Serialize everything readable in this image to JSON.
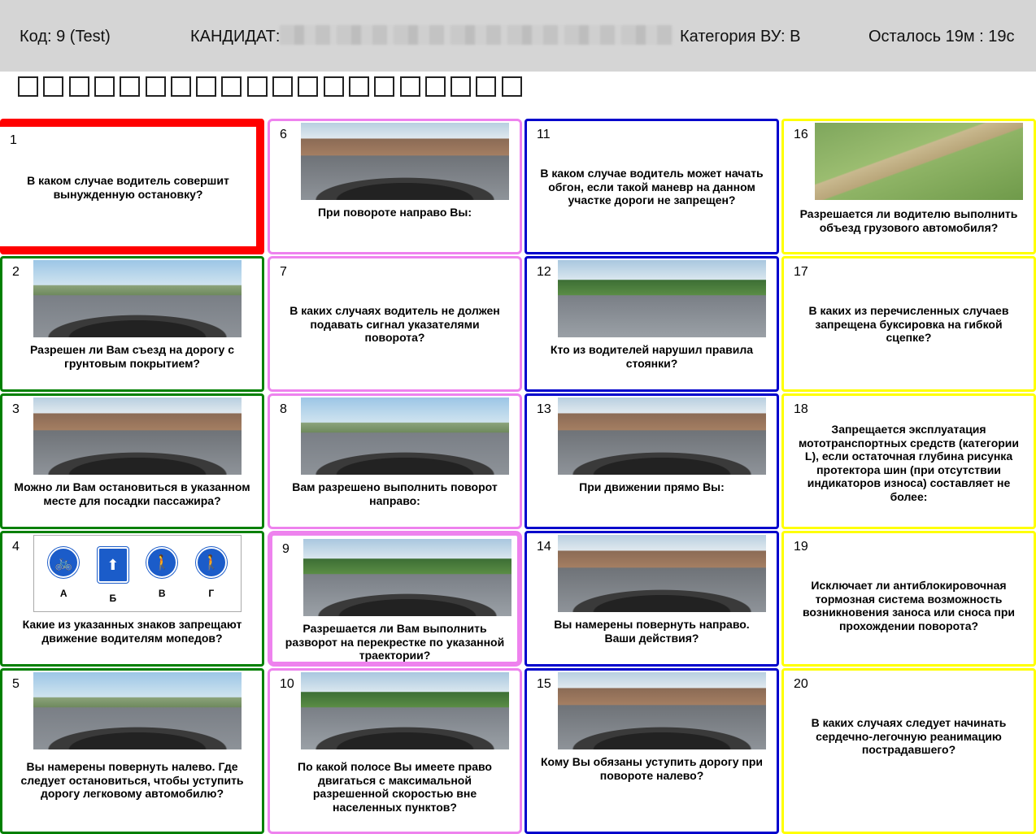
{
  "header": {
    "code": "Код: 9 (Test)",
    "candidate_label": "КАНДИДАТ:",
    "category": "Категория ВУ: B",
    "timer": "Осталось 19м : 19с"
  },
  "progress": {
    "total": 20,
    "answered": 0
  },
  "colors": {
    "red": "#ff0000",
    "green": "#008000",
    "pink": "#ee82ee",
    "blue": "#0000cc",
    "yellow": "#ffff00",
    "header_bg": "#d5d5d5"
  },
  "cards": [
    {
      "num": "1",
      "text": "В каком случае водитель совершит вынужденную остановку?",
      "border": "red",
      "image": "none"
    },
    {
      "num": "2",
      "text": "Разрешен ли Вам съезд на дорогу с грунтовым покрытием?",
      "border": "green",
      "image": "road-warning-sign"
    },
    {
      "num": "3",
      "text": "Можно ли Вам остановиться в указанном месте для посадки пассажира?",
      "border": "green",
      "image": "city-street-no-parking-sign"
    },
    {
      "num": "4",
      "text": "Какие из указанных знаков запрещают движение водителям мопедов?",
      "border": "green",
      "image": "four-signs",
      "signs": [
        {
          "label": "А",
          "icon": "bicycle-icon"
        },
        {
          "label": "Б",
          "icon": "bus-lane-icon"
        },
        {
          "label": "В",
          "icon": "pedestrian-bicycle-icon"
        },
        {
          "label": "Г",
          "icon": "pedestrian-bicycle-split-icon"
        }
      ]
    },
    {
      "num": "5",
      "text": "Вы намерены повернуть налево. Где следует остановиться, чтобы уступить дорогу легковому автомобилю?",
      "border": "green",
      "image": "intersection-yield-sign"
    },
    {
      "num": "6",
      "text": "При повороте направо Вы:",
      "border": "pink",
      "image": "intersection-police-car"
    },
    {
      "num": "7",
      "text": "В каких случаях водитель не должен подавать сигнал указателями поворота?",
      "border": "pink",
      "image": "none"
    },
    {
      "num": "8",
      "text": "Вам разрешено выполнить поворот направо:",
      "border": "pink",
      "image": "road-right-turn-sign"
    },
    {
      "num": "9",
      "text": "Разрешается ли Вам выполнить разворот на перекрестке по указанной траектории?",
      "border": "pink-thick",
      "image": "road-u-turn"
    },
    {
      "num": "10",
      "text": "По какой полосе Вы имеете право двигаться с максимальной разрешенной скоростью вне населенных пунктов?",
      "border": "pink",
      "image": "highway"
    },
    {
      "num": "11",
      "text": "В каком случае водитель может начать обгон, если такой маневр на данном участке дороги не запрещен?",
      "border": "blue",
      "image": "none"
    },
    {
      "num": "12",
      "text": "Кто из водителей нарушил правила стоянки?",
      "border": "blue",
      "image": "street-parking-3m"
    },
    {
      "num": "13",
      "text": "При движении прямо Вы:",
      "border": "blue",
      "image": "city-intersection-stop"
    },
    {
      "num": "14",
      "text": "Вы намерены повернуть направо. Ваши действия?",
      "border": "blue",
      "image": "city-street-right-turn"
    },
    {
      "num": "15",
      "text": "Кому Вы обязаны уступить дорогу при повороте налево?",
      "border": "blue",
      "image": "intersection-tram-priority"
    },
    {
      "num": "16",
      "text": "Разрешается ли водителю выполнить объезд грузового автомобиля?",
      "border": "yellow",
      "image": "railway-crossing-truck"
    },
    {
      "num": "17",
      "text": "В каких из перечисленных случаев запрещена буксировка на гибкой сцепке?",
      "border": "yellow",
      "image": "none"
    },
    {
      "num": "18",
      "text": "Запрещается эксплуатация мототранспортных средств (категории L), если остаточная глубина рисунка протектора шин (при отсутствии индикаторов износа) составляет не более:",
      "border": "yellow",
      "image": "none"
    },
    {
      "num": "19",
      "text": "Исключает ли антиблокировочная тормозная система возможность возникновения заноса или сноса при прохождении поворота?",
      "border": "yellow",
      "image": "none"
    },
    {
      "num": "20",
      "text": "В каких случаях следует начинать сердечно-легочную реанимацию пострадавшего?",
      "border": "yellow",
      "image": "none"
    }
  ]
}
